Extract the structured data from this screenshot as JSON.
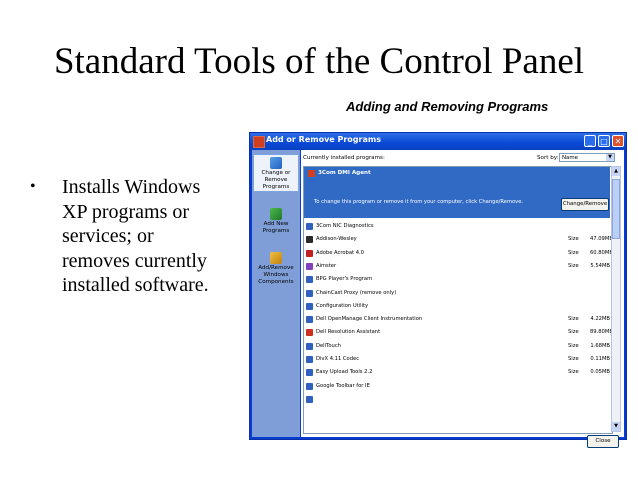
{
  "slide": {
    "title": "Standard Tools of the Control Panel",
    "subtitle": "Adding and Removing Programs",
    "bullet_marker": "•",
    "bullet": "Installs Windows\nXP programs or\nservices; or\nremoves currently\ninstalled software."
  },
  "window": {
    "title": "Add or Remove Programs",
    "buttons": {
      "minimize": "_",
      "maximize": "□",
      "close": "✕"
    },
    "sidebar": [
      {
        "label": "Change or Remove Programs",
        "icon": "change-remove-icon"
      },
      {
        "label": "Add New Programs",
        "icon": "add-program-icon"
      },
      {
        "label": "Add/Remove Windows Components",
        "icon": "windows-components-icon"
      }
    ],
    "header_label": "Currently installed programs:",
    "sort_label": "Sort by:",
    "sort_value": "Name",
    "selected": {
      "name": "3Com DMI Agent",
      "description": "To change this program or remove it from your computer, click Change/Remove.",
      "button": "Change/Remove"
    },
    "programs": [
      {
        "name": "3Com NIC Diagnostics",
        "size_label": "",
        "size": "",
        "color": "#3060c0"
      },
      {
        "name": "Addison-Wesley",
        "size_label": "Size",
        "size": "47.09MB",
        "color": "#2a2a2a"
      },
      {
        "name": "Adobe Acrobat 4.0",
        "size_label": "Size",
        "size": "60.80MB",
        "color": "#c02020"
      },
      {
        "name": "Aimster",
        "size_label": "Size",
        "size": "5.54MB",
        "color": "#8040c0"
      },
      {
        "name": "BPG Player's Program",
        "size_label": "",
        "size": "",
        "color": "#3060c0"
      },
      {
        "name": "ChainCast Proxy (remove only)",
        "size_label": "",
        "size": "",
        "color": "#3060c0"
      },
      {
        "name": "Configuration Utility",
        "size_label": "",
        "size": "",
        "color": "#3060c0"
      },
      {
        "name": "Dell OpenManage Client Instrumentation",
        "size_label": "Size",
        "size": "4.22MB",
        "color": "#3060c0"
      },
      {
        "name": "Dell Resolution Assistant",
        "size_label": "Size",
        "size": "89.80MB",
        "color": "#d03020"
      },
      {
        "name": "DellTouch",
        "size_label": "Size",
        "size": "1.68MB",
        "color": "#3060c0"
      },
      {
        "name": "DivX 4.11 Codec",
        "size_label": "Size",
        "size": "0.11MB",
        "color": "#3060c0"
      },
      {
        "name": "Easy Upload Tools 2.2",
        "size_label": "Size",
        "size": "0.05MB",
        "color": "#3060c0"
      },
      {
        "name": "Google Toolbar for IE",
        "size_label": "",
        "size": "",
        "color": "#3060c0"
      },
      {
        "name": "",
        "size_label": "",
        "size": "",
        "color": "#3060c0"
      }
    ],
    "close_button": "Close"
  }
}
